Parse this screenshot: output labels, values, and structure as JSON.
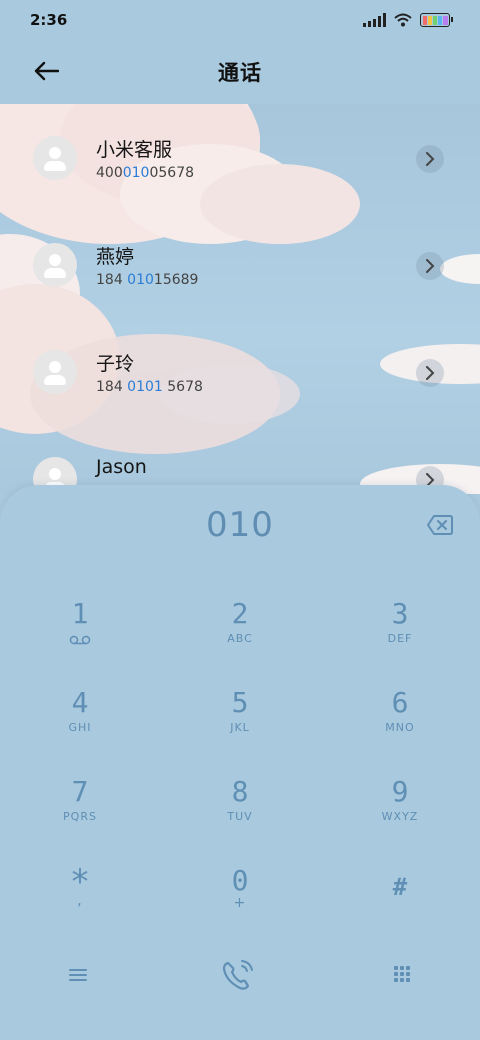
{
  "status_bar": {
    "time": "2:36"
  },
  "header": {
    "title": "通话"
  },
  "contacts": [
    {
      "name": "小米客服",
      "number_parts": [
        "400",
        "010",
        "05678"
      ]
    },
    {
      "name": "燕婷",
      "number_parts": [
        "184 ",
        "010",
        "15689"
      ]
    },
    {
      "name": "子玲",
      "number_parts": [
        "184 ",
        "0101",
        " 5678"
      ]
    },
    {
      "name": "Jason",
      "number_parts": [
        "",
        "",
        ""
      ]
    }
  ],
  "dialpad": {
    "display": "010",
    "keys": [
      {
        "digit": "1",
        "letters": ""
      },
      {
        "digit": "2",
        "letters": "ABC"
      },
      {
        "digit": "3",
        "letters": "DEF"
      },
      {
        "digit": "4",
        "letters": "GHI"
      },
      {
        "digit": "5",
        "letters": "JKL"
      },
      {
        "digit": "6",
        "letters": "MNO"
      },
      {
        "digit": "7",
        "letters": "PQRS"
      },
      {
        "digit": "8",
        "letters": "TUV"
      },
      {
        "digit": "9",
        "letters": "WXYZ"
      },
      {
        "digit": "*",
        "letters": ","
      },
      {
        "digit": "0",
        "letters": "+"
      },
      {
        "digit": "#",
        "letters": ""
      }
    ]
  },
  "colors": {
    "accent": "#5f8fb4",
    "highlight": "#2a7dd6",
    "background": "#a9c9de"
  },
  "icons": [
    "back-arrow-icon",
    "chevron-right-icon",
    "backspace-icon",
    "voicemail-icon",
    "menu-icon",
    "call-icon",
    "dialpad-grid-icon"
  ]
}
